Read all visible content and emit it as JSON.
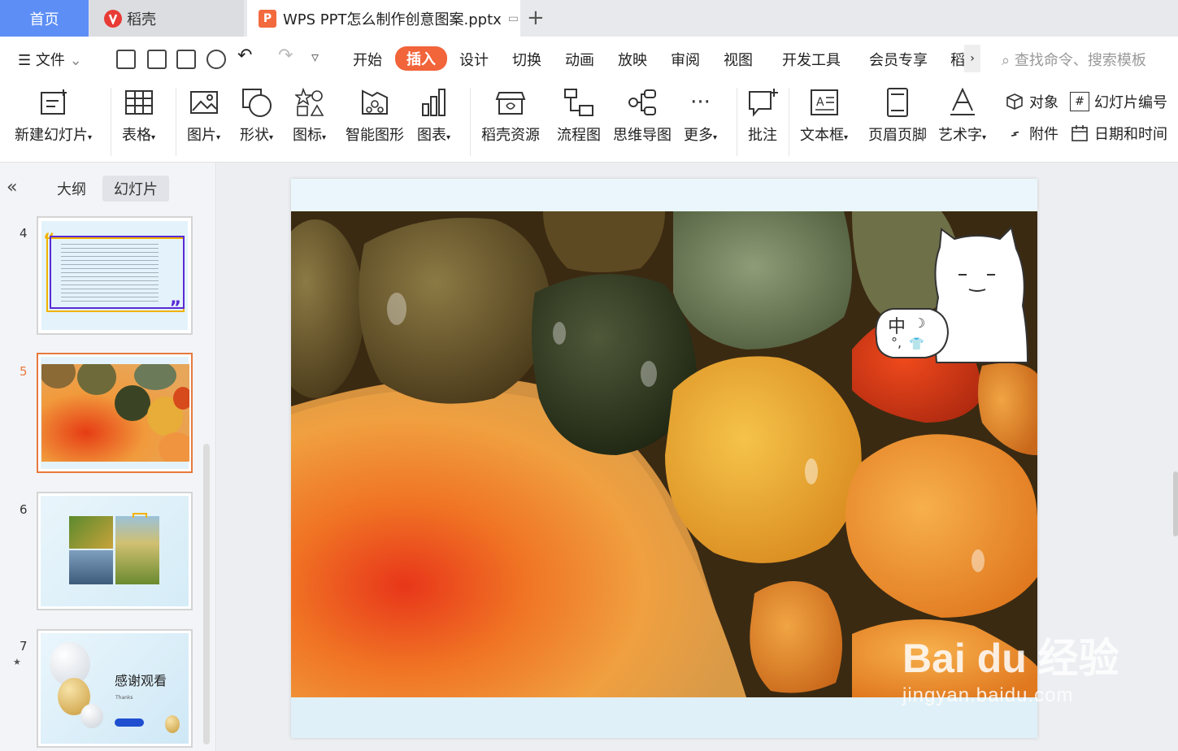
{
  "tabs": {
    "home": "首页",
    "daoke": "稻壳",
    "document": "WPS PPT怎么制作创意图案.pptx",
    "add": "+"
  },
  "menu": {
    "file": "文件",
    "items": [
      "开始",
      "插入",
      "设计",
      "切换",
      "动画",
      "放映",
      "审阅",
      "视图",
      "开发工具",
      "会员专享",
      "稻"
    ],
    "active": "插入",
    "search_placeholder": "查找命令、搜索模板"
  },
  "ribbon": {
    "new_slide": "新建幻灯片",
    "table": "表格",
    "picture": "图片",
    "shape": "形状",
    "icon": "图标",
    "smart_graphic": "智能图形",
    "chart": "图表",
    "daoke_resources": "稻壳资源",
    "flowchart": "流程图",
    "mindmap": "思维导图",
    "more": "更多",
    "comment": "批注",
    "textbox": "文本框",
    "header_footer": "页眉页脚",
    "wordart": "艺术字",
    "object": "对象",
    "slide_number": "幻灯片编号",
    "attachment": "附件",
    "date_time": "日期和时间"
  },
  "panel": {
    "outline": "大纲",
    "slides": "幻灯片",
    "numbers": [
      "4",
      "5",
      "6",
      "7"
    ],
    "thanks_title": "感谢观看",
    "thanks_sub": "Thanks"
  },
  "sticker": {
    "text": "中",
    "sub": "°,"
  },
  "watermark": {
    "logo": "Bai du 经验",
    "url": "jingyan.baidu.com"
  },
  "colors": {
    "accent": "#f2643a",
    "home_tab": "#5d8ef6",
    "selected_thumb": "#e8793e"
  }
}
